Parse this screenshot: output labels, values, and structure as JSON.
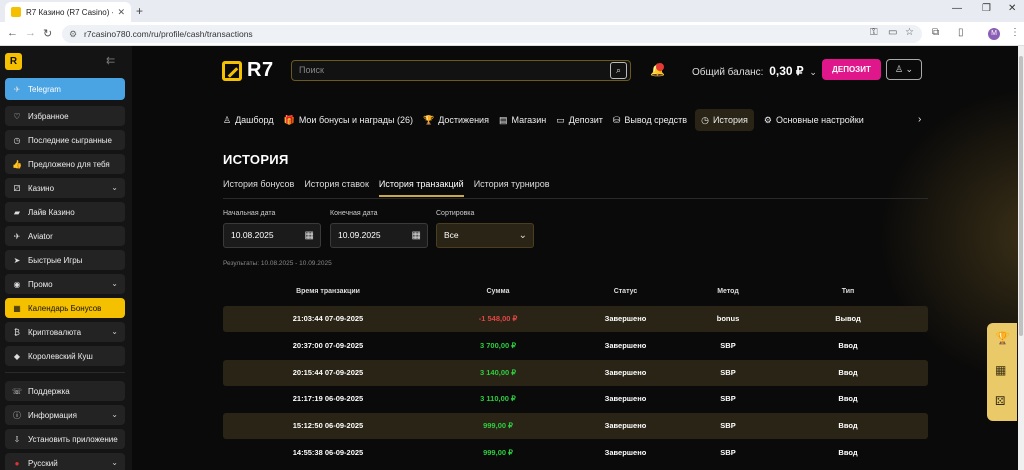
{
  "browser": {
    "tab_title": "R7 Казино (R7 Casino) - офиц",
    "tab_close": "✕",
    "new_tab": "+",
    "url": "r7casino780.com/ru/profile/cash/transactions",
    "profile_initial": "M"
  },
  "sidebar": {
    "logo": "R",
    "items": [
      {
        "label": "Telegram",
        "icon": "telegram-icon",
        "glyph": "✈"
      },
      {
        "label": "Избранное",
        "icon": "heart-icon",
        "glyph": "♡"
      },
      {
        "label": "Последние сыгранные",
        "icon": "clock-icon",
        "glyph": "◷"
      },
      {
        "label": "Предложено для тебя",
        "icon": "thumb-icon",
        "glyph": "👍"
      },
      {
        "label": "Казино",
        "icon": "casino-icon",
        "glyph": "⚂"
      },
      {
        "label": "Лайв Казино",
        "icon": "live-icon",
        "glyph": "▰"
      },
      {
        "label": "Aviator",
        "icon": "plane-icon",
        "glyph": "✈"
      },
      {
        "label": "Быстрые Игры",
        "icon": "rocket-icon",
        "glyph": "➤"
      },
      {
        "label": "Промо",
        "icon": "promo-icon",
        "glyph": "◉"
      },
      {
        "label": "Календарь Бонусов",
        "icon": "calendar-icon",
        "glyph": "▦"
      },
      {
        "label": "Криптовалюта",
        "icon": "crypto-icon",
        "glyph": "₿"
      },
      {
        "label": "Королевский Куш",
        "icon": "crown-icon",
        "glyph": "◆"
      },
      {
        "label": "Поддержка",
        "icon": "support-icon",
        "glyph": "☏"
      },
      {
        "label": "Информация",
        "icon": "info-icon",
        "glyph": "ⓘ"
      },
      {
        "label": "Установить приложение",
        "icon": "download-icon",
        "glyph": "⇩"
      },
      {
        "label": "Русский",
        "icon": "flag-ru-icon",
        "glyph": "●"
      }
    ]
  },
  "header": {
    "logo_text": "R7",
    "search_placeholder": "Поиск",
    "notif_count": "",
    "balance_label": "Общий баланс:",
    "balance_value": "0,30 ₽",
    "deposit_label": "ДЕПОЗИТ"
  },
  "nav": {
    "tabs": [
      {
        "label": "Дашборд",
        "glyph": "♙"
      },
      {
        "label": "Мои бонусы и награды (26)",
        "glyph": "🎁"
      },
      {
        "label": "Достижения",
        "glyph": "🏆"
      },
      {
        "label": "Магазин",
        "glyph": "▤"
      },
      {
        "label": "Депозит",
        "glyph": "▭"
      },
      {
        "label": "Вывод средств",
        "glyph": "⛁"
      },
      {
        "label": "История",
        "glyph": "◷"
      },
      {
        "label": "Основные настройки",
        "glyph": "⚙"
      }
    ]
  },
  "page": {
    "title": "ИСТОРИЯ",
    "sub_tabs": [
      "История бонусов",
      "История ставок",
      "История транзакций",
      "История турниров"
    ],
    "filters": {
      "start_label": "Начальная дата",
      "start_value": "10.08.2025",
      "end_label": "Конечная дата",
      "end_value": "10.09.2025",
      "sort_label": "Сортировка",
      "sort_value": "Все"
    },
    "results": "Результаты: 10.08.2025 - 10.09.2025"
  },
  "table": {
    "headers": [
      "Время транзакции",
      "Сумма",
      "Статус",
      "Метод",
      "Тип"
    ],
    "rows": [
      {
        "time": "21:03:44 07-09-2025",
        "amount": "-1 548,00 ₽",
        "status": "Завершено",
        "method": "bonus",
        "type": "Вывод"
      },
      {
        "time": "20:37:00 07-09-2025",
        "amount": "3 700,00 ₽",
        "status": "Завершено",
        "method": "SBP",
        "type": "Ввод"
      },
      {
        "time": "20:15:44 07-09-2025",
        "amount": "3 140,00 ₽",
        "status": "Завершено",
        "method": "SBP",
        "type": "Ввод"
      },
      {
        "time": "21:17:19 06-09-2025",
        "amount": "3 110,00 ₽",
        "status": "Завершено",
        "method": "SBP",
        "type": "Ввод"
      },
      {
        "time": "15:12:50 06-09-2025",
        "amount": "999,00 ₽",
        "status": "Завершено",
        "method": "SBP",
        "type": "Ввод"
      },
      {
        "time": "14:55:38 06-09-2025",
        "amount": "999,00 ₽",
        "status": "Завершено",
        "method": "SBP",
        "type": "Ввод"
      }
    ]
  },
  "colors": {
    "accent": "#f5c000",
    "deposit": "#e0178b",
    "negative": "#e04646",
    "positive": "#2ecc40",
    "row_alt": "#2a2416"
  }
}
